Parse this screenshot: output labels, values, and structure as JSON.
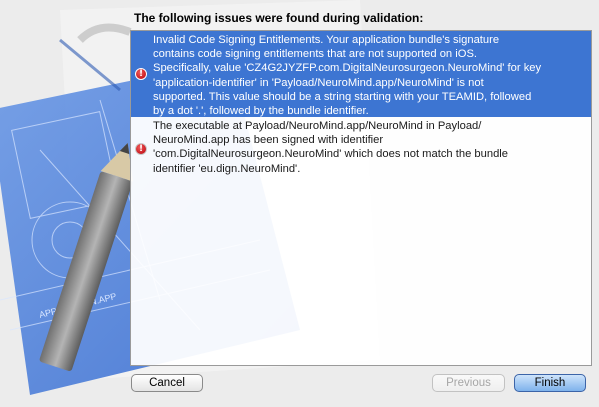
{
  "dialog": {
    "heading": "The following issues were found during validation:"
  },
  "issues": [
    {
      "severity": "error",
      "selected": true,
      "text": "Invalid Code Signing Entitlements. Your application bundle's signature\ncontains code signing entitlements that are not supported on iOS.\nSpecifically, value 'CZ4G2JYZFP.com.DigitalNeurosurgeon.NeuroMind' for key\n'application-identifier' in 'Payload/NeuroMind.app/NeuroMind' is not\nsupported. This value should be a string starting with your TEAMID, followed\nby a dot '.', followed by the bundle identifier."
    },
    {
      "severity": "error",
      "selected": false,
      "text": "The executable at Payload/NeuroMind.app/NeuroMind in Payload/\nNeuroMind.app has been signed with identifier\n'com.DigitalNeurosurgeon.NeuroMind' which does not match the bundle\nidentifier 'eu.dign.NeuroMind'."
    }
  ],
  "buttons": {
    "cancel": "Cancel",
    "previous": "Previous",
    "finish": "Finish"
  },
  "icons": {
    "issue": "error-icon",
    "background": "blueprint-application-artwork"
  },
  "colors": {
    "selection": "#3d75d2",
    "error": "#d0101a",
    "blueprint": "#4a7fd8",
    "pencil": "#8c8c8c"
  }
}
